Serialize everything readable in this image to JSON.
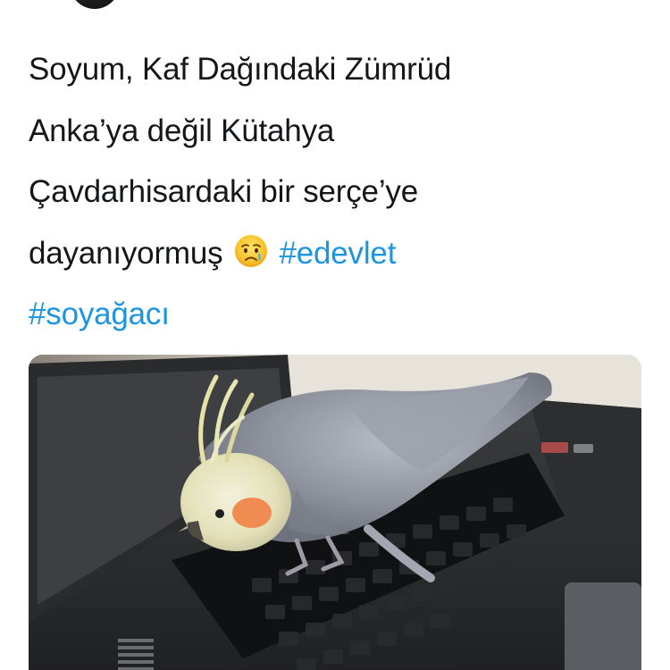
{
  "tweet": {
    "lines": [
      "Soyum, Kaf Dağındaki Zümrüd",
      "Anka’ya değil Kütahya",
      "Çavdarhisardaki bir serçe’ye",
      "dayanıyormuş"
    ],
    "emoji": "crying-face",
    "hashtags": [
      "#edevlet",
      "#soyağacı"
    ]
  },
  "media": {
    "subject": "cockatiel-on-laptop-keyboard"
  },
  "colors": {
    "text": "#14171a",
    "hashtag": "#1b95e0",
    "background": "#ffffff"
  }
}
